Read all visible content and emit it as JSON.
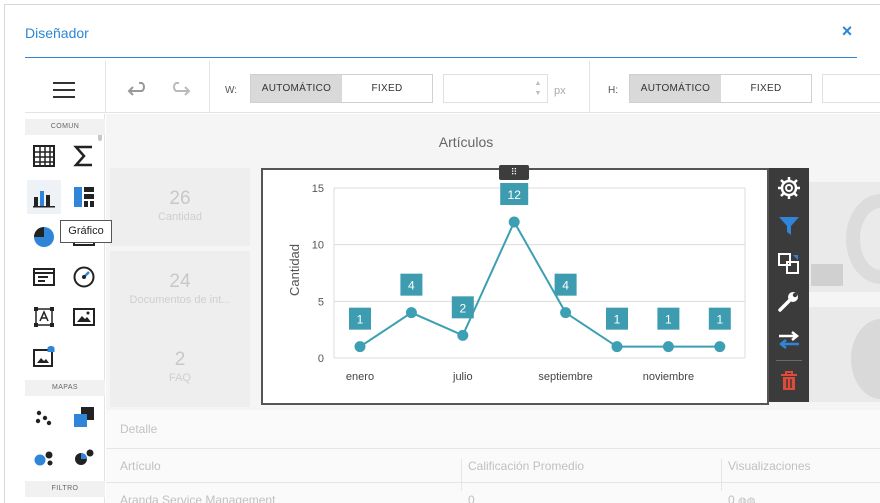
{
  "window": {
    "title": "Diseñador",
    "close_glyph": "×"
  },
  "toolbar": {
    "width_label": "W:",
    "height_label": "H:",
    "width_modes": [
      "AUTOMÁTICO",
      "FIXED"
    ],
    "height_modes": [
      "AUTOMÁTICO",
      "FIXED"
    ],
    "active_mode": "AUTOMÁTICO",
    "width_value": "",
    "unit": "px"
  },
  "left_panel": {
    "sections": [
      "COMUN",
      "MAPAS",
      "FILTRO"
    ],
    "tooltip": "Gráfico",
    "common_tools": [
      "grid-icon",
      "sigma-icon",
      "bar-chart-icon",
      "treemap-icon",
      "pie-chart-icon",
      "card-icon",
      "text-box-icon",
      "gauge-icon",
      "bounding-box-text-icon",
      "image-icon",
      "bound-image-icon"
    ],
    "map_tools": [
      "scatter-map-icon",
      "choropleth-map-icon",
      "bubble-map-icon",
      "pie-map-icon"
    ]
  },
  "dashboard": {
    "title": "Artículos",
    "kpis": [
      {
        "value": "26",
        "label": "Cantidad"
      },
      {
        "value": "24",
        "label": "Documentos de int..."
      },
      {
        "value": "2",
        "label": "FAQ"
      }
    ],
    "detail": {
      "title": "Detalle",
      "columns": [
        "Artículo",
        "Calificación Promedio",
        "Visualizaciones"
      ],
      "rows": [
        [
          "Aranda Service Management",
          "0",
          "0"
        ]
      ]
    }
  },
  "chart_data": {
    "type": "line",
    "x": [
      "enero",
      "",
      "julio",
      "",
      "septiembre",
      "",
      "noviembre",
      ""
    ],
    "x_tick_labels": [
      "enero",
      "julio",
      "septiembre",
      "noviembre"
    ],
    "values": [
      1,
      4,
      2,
      12,
      4,
      1,
      1,
      1
    ],
    "ylabel": "Cantidad",
    "ylim": [
      0,
      15
    ],
    "y_ticks": [
      0,
      5,
      10,
      15
    ],
    "grid": true,
    "color": "#3d9fb3",
    "label_color": "#3e9cb0"
  },
  "side_tools": [
    "gear-icon",
    "filter-icon",
    "convert-icon",
    "wrench-icon",
    "swap-icon",
    "trash-icon"
  ],
  "colors": {
    "accent": "#2b86d6",
    "series": "#3d9fb3",
    "filter": "#2f86d8",
    "delete": "#e04a3a"
  }
}
